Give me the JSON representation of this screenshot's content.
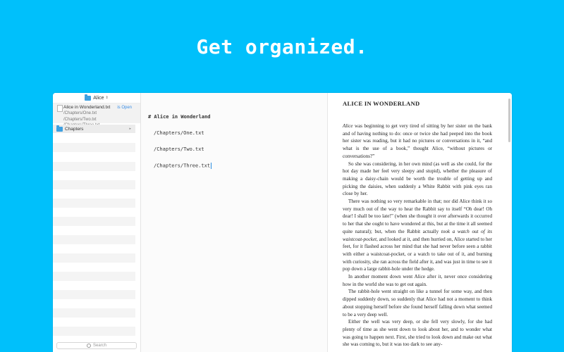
{
  "headline": "Get organized.",
  "sidebar": {
    "folder_title": "Alice",
    "file": {
      "name": "Alice in Wonderland.txt",
      "open_label": "is Open",
      "subtitle": "/Chapters/One.txt /Chapters/Two.txt /Chapters/Three.txt"
    },
    "folder_label": "Chapters",
    "search_placeholder": "Search"
  },
  "editor": {
    "heading": "# Alice in Wonderland",
    "lines": [
      "/Chapters/One.txt",
      "/Chapters/Two.txt",
      "/Chapters/Three.txt"
    ]
  },
  "preview": {
    "title": "ALICE IN WONDERLAND",
    "p1_em": "Alice",
    "p1_rest": " was beginning to get very tired of sitting by her sister on the bank and of having nothing to do: once or twice she had peeped into the book her sister was reading, but it had no pictures or conversations in it, “and what is the use of a book,” thought Alice, “without pictures or conversations?”",
    "p2": "So she was considering, in her own mind (as well as she could, for the hot day made her feel very sleepy and stupid), whether the pleasure of making a daisy-chain would be worth the trouble of getting up and picking the daisies, when suddenly a White Rabbit with pink eyes ran close by her.",
    "p3a": "There was nothing so very remarkable in that; nor did Alice think it so very much out of the way to hear the Rabbit say to itself “Oh dear! Oh dear! I shall be too late!” (when she thought it over afterwards it occurred to her that she ought to have wondered at this, but at the time it all seemed quite natural); but, when the Rabbit actually ",
    "p3_em": "took a watch out of its waistcoat-pocket",
    "p3b": ", and looked at it, and then hurried on, Alice started to her feet, for it flashed across her mind that she had never before seen a rabbit with either a waistcoat-pocket, or a watch to take out of it, and burning with curiosity, she ran across the field after it, and was just in time to see it pop down a large rabbit-hole under the hedge.",
    "p4": "In another moment down went Alice after it, never once considering how in the world she was to get out again.",
    "p5": "The rabbit-hole went straight on like a tunnel for some way, and then dipped suddenly down, so suddenly that Alice had not a moment to think about stopping herself before she found herself falling down what seemed to be a very deep well.",
    "p6": "Either the well was very deep, or she fell very slowly, for she had plenty of time as she went down to look about her, and to wonder what was going to happen next. First, she tried to look down and make out what she was coming to, but it was too dark to see any-"
  },
  "colors": {
    "background": "#00c0fb",
    "accent": "#3a8ee6",
    "folder": "#3fa0e0"
  }
}
